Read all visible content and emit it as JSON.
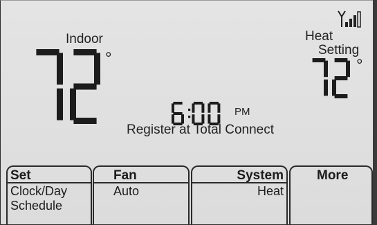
{
  "indoor": {
    "label": "Indoor",
    "temperature": "72",
    "unit": "°"
  },
  "setpoint": {
    "label_line1": "Heat",
    "label_line2": "Setting",
    "temperature": "72",
    "unit": "°"
  },
  "clock": {
    "time": "6:00",
    "period": "PM"
  },
  "message": "Register at Total Connect",
  "softkeys": {
    "set": {
      "title": "Set",
      "line1": "Clock/Day",
      "line2": "Schedule"
    },
    "fan": {
      "title": "Fan",
      "value": "Auto"
    },
    "system": {
      "title": "System",
      "value": "Heat"
    },
    "more": {
      "title": "More"
    }
  },
  "icons": {
    "signal": "wifi-signal-icon"
  },
  "colors": {
    "lcd_background": "#dedede",
    "segment": "#1c1c1c"
  }
}
